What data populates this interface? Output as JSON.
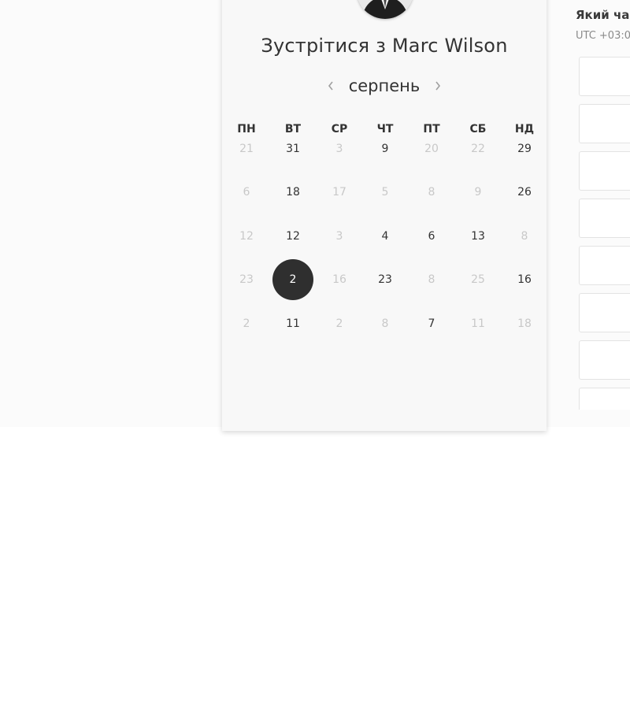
{
  "calendar": {
    "title": "Зустрітися з Marc Wilson",
    "month": "серпень",
    "weekdays": [
      "ПН",
      "ВТ",
      "СР",
      "ЧТ",
      "ПТ",
      "СБ",
      "НД"
    ],
    "weeks": [
      [
        {
          "label": "21",
          "available": false
        },
        {
          "label": "31",
          "available": true
        },
        {
          "label": "3",
          "available": false
        },
        {
          "label": "9",
          "available": true
        },
        {
          "label": "20",
          "available": false
        },
        {
          "label": "22",
          "available": false
        },
        {
          "label": "29",
          "available": true
        }
      ],
      [
        {
          "label": "6",
          "available": false
        },
        {
          "label": "18",
          "available": true
        },
        {
          "label": "17",
          "available": false
        },
        {
          "label": "5",
          "available": false
        },
        {
          "label": "8",
          "available": false
        },
        {
          "label": "9",
          "available": false
        },
        {
          "label": "26",
          "available": true
        }
      ],
      [
        {
          "label": "12",
          "available": false
        },
        {
          "label": "12",
          "available": true
        },
        {
          "label": "3",
          "available": false
        },
        {
          "label": "4",
          "available": true
        },
        {
          "label": "6",
          "available": true
        },
        {
          "label": "13",
          "available": true
        },
        {
          "label": "8",
          "available": false
        }
      ],
      [
        {
          "label": "23",
          "available": false
        },
        {
          "label": "2",
          "available": true,
          "selected": true
        },
        {
          "label": "16",
          "available": false
        },
        {
          "label": "23",
          "available": true
        },
        {
          "label": "8",
          "available": false
        },
        {
          "label": "25",
          "available": false
        },
        {
          "label": "16",
          "available": true
        }
      ],
      [
        {
          "label": "2",
          "available": false
        },
        {
          "label": "11",
          "available": true
        },
        {
          "label": "2",
          "available": false
        },
        {
          "label": "8",
          "available": false
        },
        {
          "label": "7",
          "available": true
        },
        {
          "label": "11",
          "available": false
        },
        {
          "label": "18",
          "available": false
        }
      ]
    ]
  },
  "time_panel": {
    "title": "Який час",
    "timezone": "UTC +03:0",
    "slot_count": 8
  },
  "colors": {
    "selected_day": "#2f2f2f",
    "available_text": "#333333",
    "unavailable_text": "#c8c8c8"
  },
  "icons": {
    "prev": "chevron-left-icon",
    "next": "chevron-right-icon",
    "avatar": "avatar-photo"
  }
}
